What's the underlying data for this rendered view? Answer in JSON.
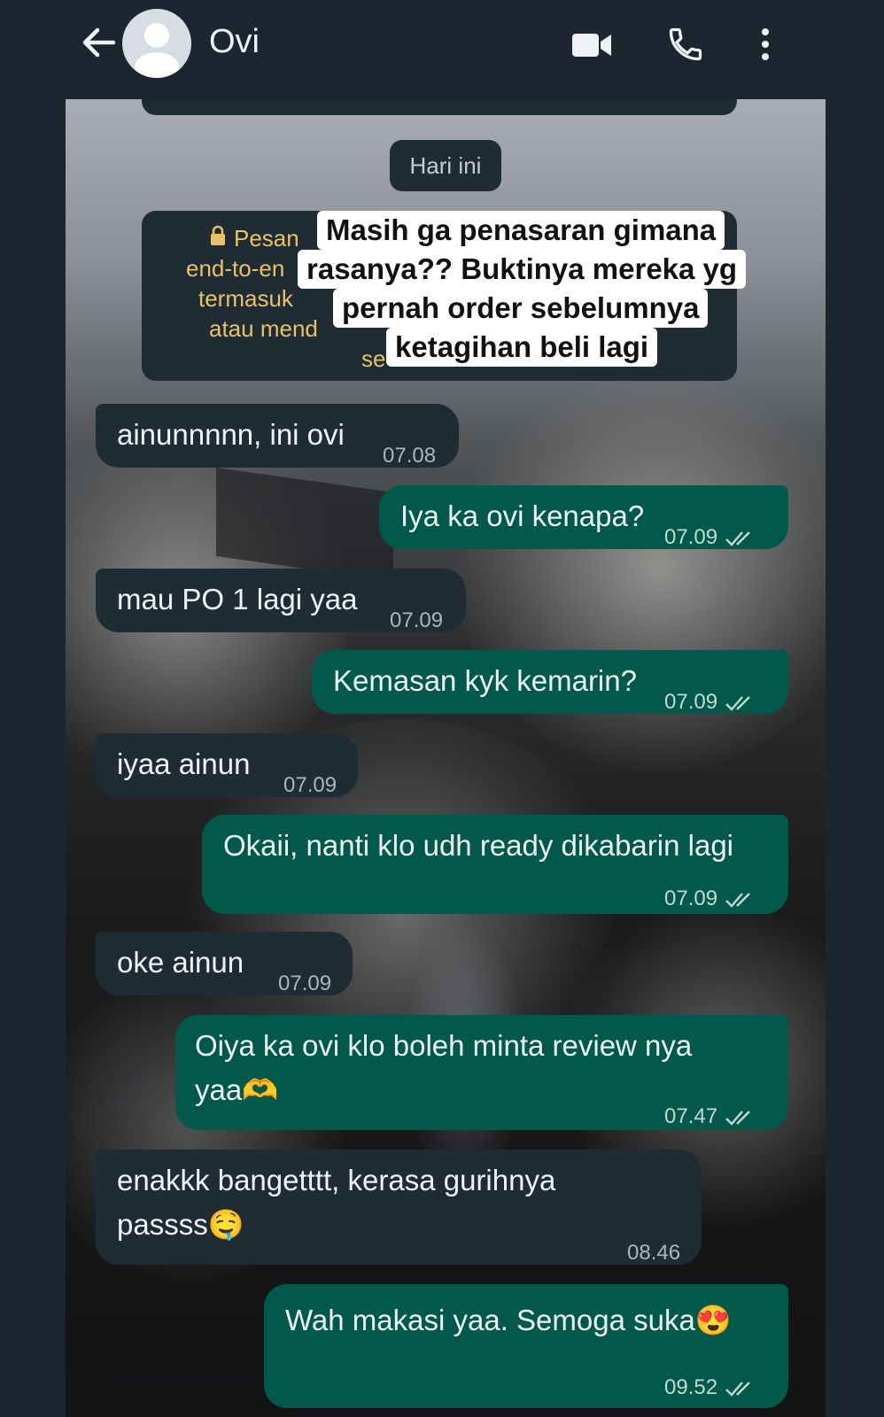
{
  "header": {
    "contact_name": "Ovi",
    "icons": [
      "back-arrow-icon",
      "avatar-placeholder-icon",
      "video-call-icon",
      "phone-call-icon",
      "more-vertical-icon"
    ]
  },
  "chat": {
    "day_label": "Hari ini",
    "encryption_lines": [
      "Pesan",
      "end-to-en",
      "termasuk",
      "atau mend",
      "se"
    ],
    "overlay_caption": [
      "Masih ga penasaran gimana",
      "rasanya?? Buktinya mereka yg",
      "pernah order sebelumnya",
      "ketagihan beli lagi"
    ],
    "messages": [
      {
        "dir": "in",
        "text": "ainunnnnn, ini ovi",
        "time": "07.08"
      },
      {
        "dir": "out",
        "text": "Iya ka ovi kenapa?",
        "time": "07.09"
      },
      {
        "dir": "in",
        "text": "mau PO 1 lagi yaa",
        "time": "07.09"
      },
      {
        "dir": "out",
        "text": "Kemasan kyk kemarin?",
        "time": "07.09"
      },
      {
        "dir": "in",
        "text": "iyaa ainun",
        "time": "07.09"
      },
      {
        "dir": "out",
        "text": "Okaii, nanti klo udh ready dikabarin lagi",
        "time": "07.09"
      },
      {
        "dir": "in",
        "text": "oke ainun",
        "time": "07.09"
      },
      {
        "dir": "out",
        "text": "Oiya ka ovi klo boleh minta review nya yaa🫶",
        "time": "07.47"
      },
      {
        "dir": "in",
        "text": "enakkk bangetttt, kerasa gurihnya passss🤤",
        "time": "08.46"
      },
      {
        "dir": "out",
        "text": "Wah makasi yaa. Semoga suka😍",
        "time": "09.52"
      }
    ]
  },
  "colors": {
    "app_bg": "#1c2630",
    "incoming_bubble": "#1f2c34",
    "outgoing_bubble": "#00594a",
    "encryption_text": "#e8c169"
  }
}
